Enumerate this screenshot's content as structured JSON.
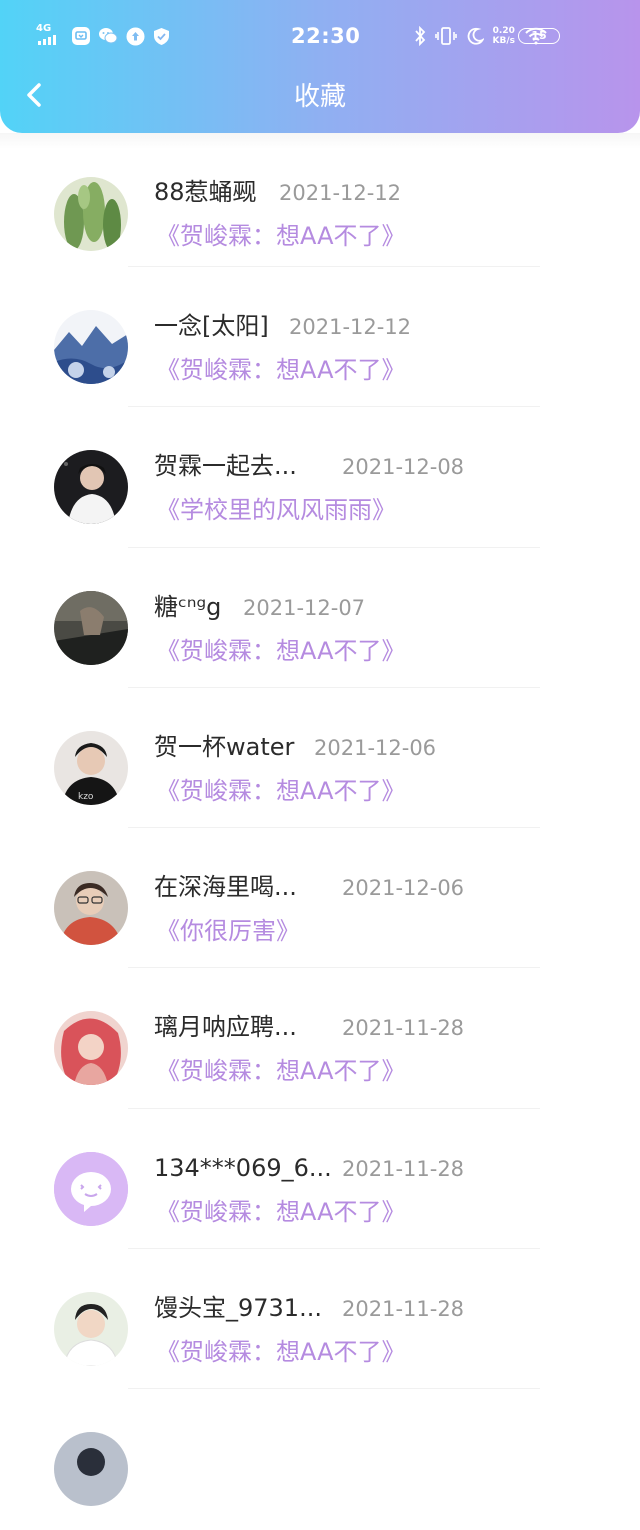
{
  "status_bar": {
    "network": "4G",
    "time": "22:30",
    "speed_value": "0.20",
    "speed_unit": "KB/s",
    "battery": "15"
  },
  "header": {
    "title": "收藏"
  },
  "favorites": [
    {
      "name": "88惹蛹觋",
      "date": "2021-12-12",
      "book": "《贺峻霖：想AA不了》",
      "avatar": "cactus"
    },
    {
      "name": "一念[太阳]",
      "date": "2021-12-12",
      "book": "《贺峻霖：想AA不了》",
      "avatar": "blue-porcelain"
    },
    {
      "name": "贺霖一起去...",
      "date": "2021-12-08",
      "book": "《学校里的风风雨雨》",
      "avatar": "singer-photo"
    },
    {
      "name": "糖ᶜⁿᵍg",
      "date": "2021-12-07",
      "book": "《贺峻霖：想AA不了》",
      "avatar": "piano-photo"
    },
    {
      "name": "贺一杯water",
      "date": "2021-12-06",
      "book": "《贺峻霖：想AA不了》",
      "avatar": "boy-black-shirt"
    },
    {
      "name": "在深海里喝...",
      "date": "2021-12-06",
      "book": "《你很厉害》",
      "avatar": "boy-red-hoodie"
    },
    {
      "name": "璃月呐应聘...",
      "date": "2021-11-28",
      "book": "《贺峻霖：想AA不了》",
      "avatar": "anime-girl"
    },
    {
      "name": "134***069_6...",
      "date": "2021-11-28",
      "book": "《贺峻霖：想AA不了》",
      "avatar": "default-chat"
    },
    {
      "name": "馒头宝_9731...",
      "date": "2021-11-28",
      "book": "《贺峻霖：想AA不了》",
      "avatar": "boy-portrait"
    },
    {
      "name": "",
      "date": "",
      "book": "",
      "avatar": "partial"
    }
  ],
  "colors": {
    "header_gradient": [
      "#52d3f7",
      "#8fb0f2",
      "#b894ec"
    ],
    "book_title": "#b58be0",
    "name_text": "#2b2b2b",
    "date_text": "#9a9a9a",
    "default_avatar": "#d9b8f5"
  }
}
